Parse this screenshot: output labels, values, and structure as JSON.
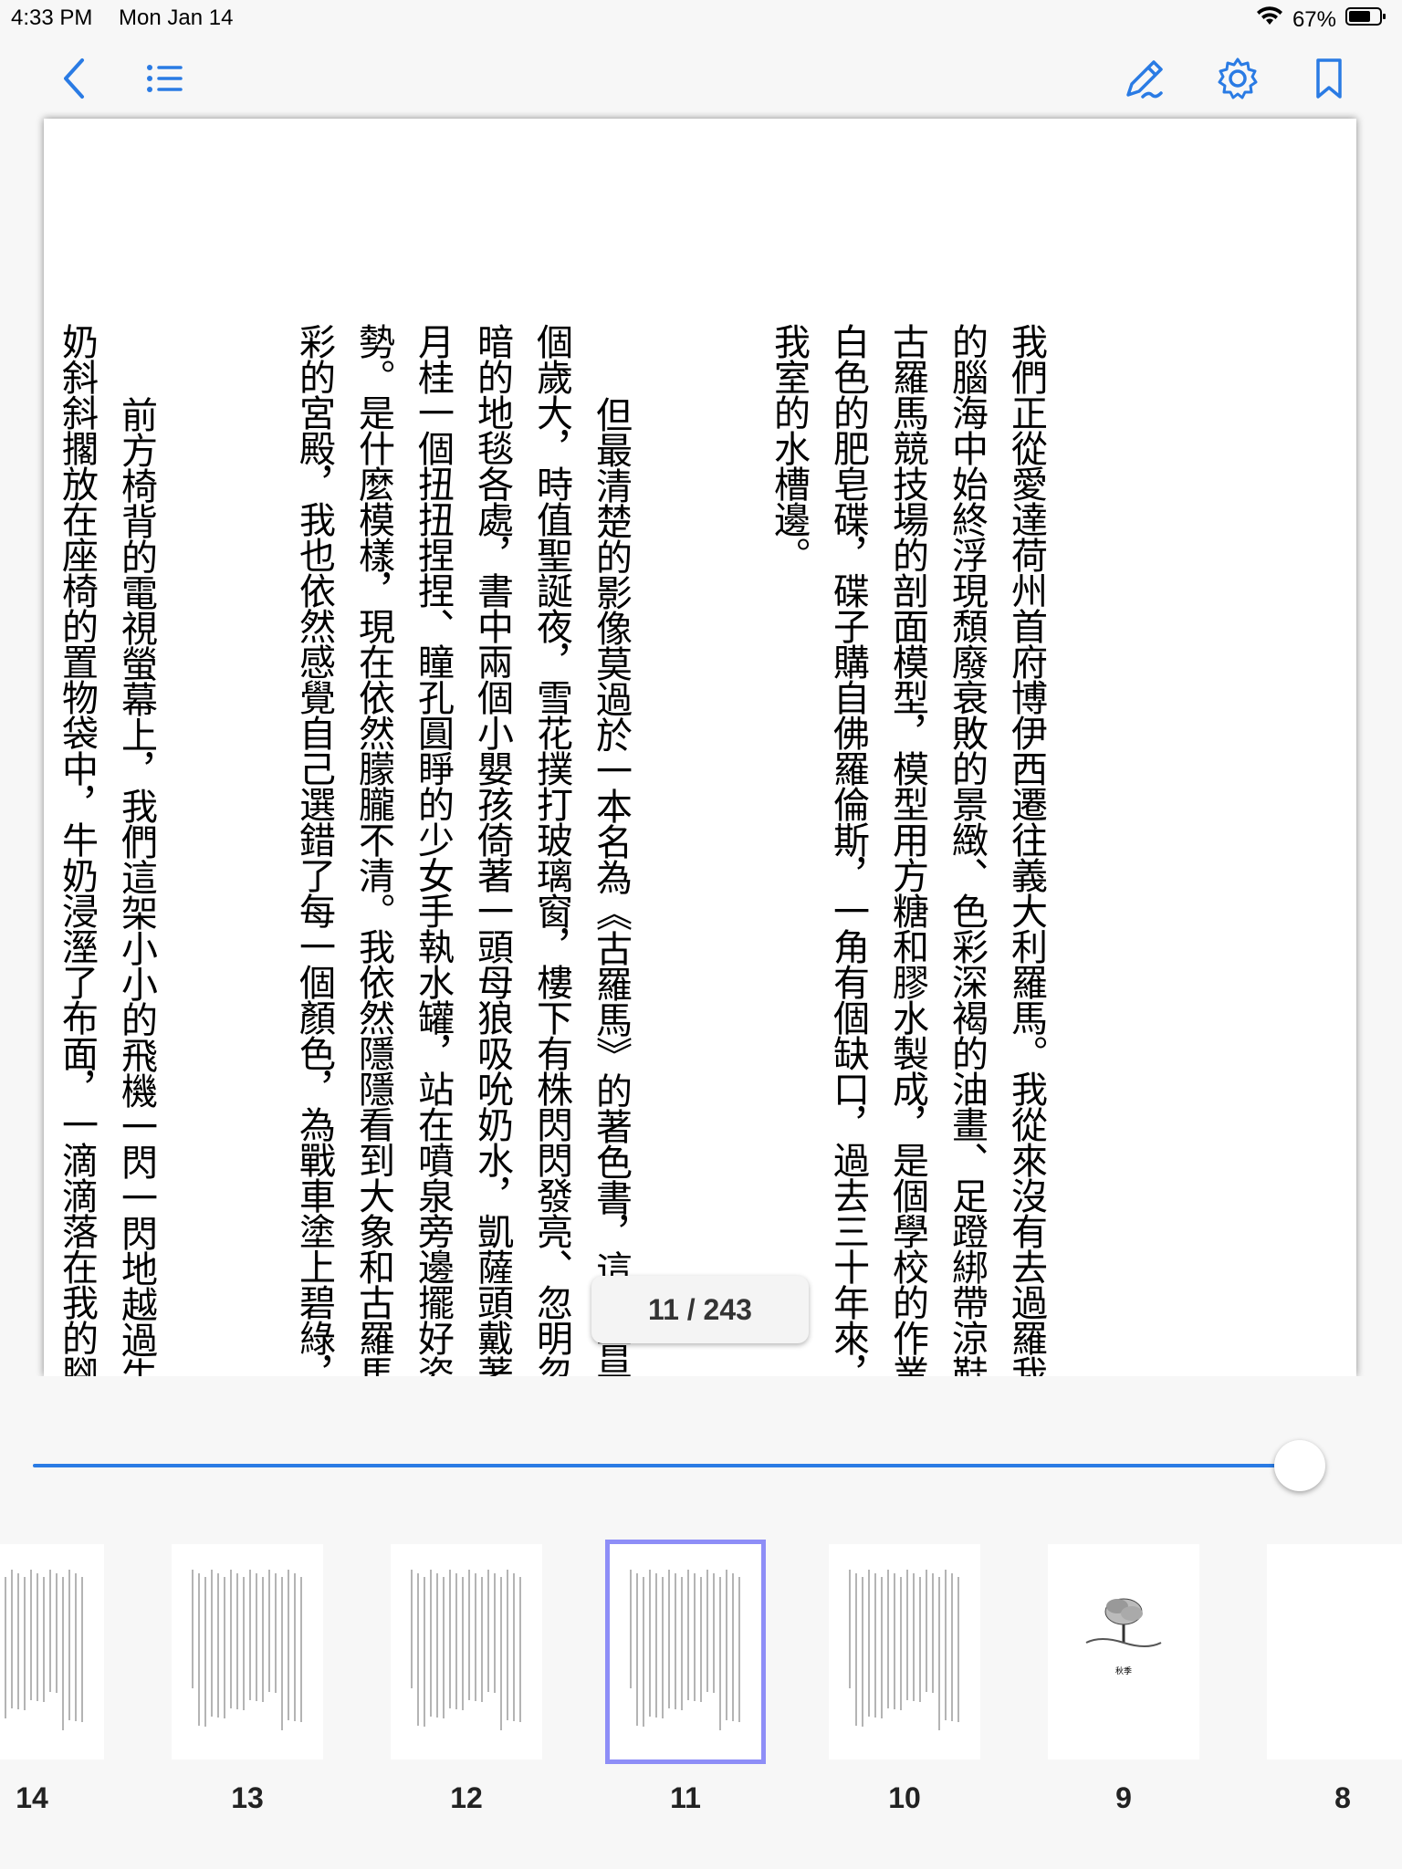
{
  "status_bar": {
    "time": "4:33 PM",
    "date": "Mon Jan 14",
    "battery": "67%"
  },
  "toolbar": {
    "back_icon": "chevron-left-icon",
    "toc_icon": "list-icon",
    "annotate_icon": "pen-icon",
    "settings_icon": "gear-icon",
    "bookmark_icon": "bookmark-icon",
    "accent_color": "#2a7be4"
  },
  "page": {
    "paragraphs": [
      "我們正從愛達荷州首府博伊西遷往義大利羅馬。我從來沒有去過羅我的腦海中始終浮現頹廢衰敗的景緻、色彩深褐的油畫、足蹬綁帶涼鞋古羅馬競技場的剖面模型，模型用方糖和膠水製成，是個學校的作業白色的肥皂碟，碟子購自佛羅倫斯，一角有個缺口，過去三十年來，我室的水槽邊。",
      "但最清楚的影像莫過於一本名為《古羅馬》的著色書，這本書是個歲大，時值聖誕夜，雪花撲打玻璃窗，樓下有株閃閃發亮、忽明忽暗的地毯各處，書中兩個小嬰孩倚著一頭母狼吸吮奶水，凱薩頭戴著月桂一個扭扭捏捏、瞳孔圓睜的少女手執水罐，站在噴泉旁邊擺好姿勢。是什麼模樣，現在依然朦朧不清。我依然隱隱看到大象和古羅馬彩的宮殿，我也依然感覺自己選錯了每一個顏色，為戰車塗上碧綠，",
      "前方椅背的電視螢幕上，我們這架小小的飛機一閃一閃地越過牛奶斜斜擱放在座椅的置物袋中，牛奶浸溼了布面，一滴滴落在我的腳伸手扶正，生怕吵醒沉睡中的亨利。機上放映了一部琳賽．蘿涵的電影蒙》，播映期間，我們已從北美飛至歐洲。機外的氣溫是華氏零下六十"
    ]
  },
  "page_indicator": "11 / 243",
  "slider": {
    "position_fraction": 0.95
  },
  "thumbnails": [
    {
      "label": "14",
      "caption": ""
    },
    {
      "label": "13",
      "caption": ""
    },
    {
      "label": "12",
      "caption": ""
    },
    {
      "label": "11",
      "caption": "",
      "active": true
    },
    {
      "label": "10",
      "caption": ""
    },
    {
      "label": "9",
      "caption": "秋季"
    },
    {
      "label": "8",
      "caption": ""
    }
  ]
}
